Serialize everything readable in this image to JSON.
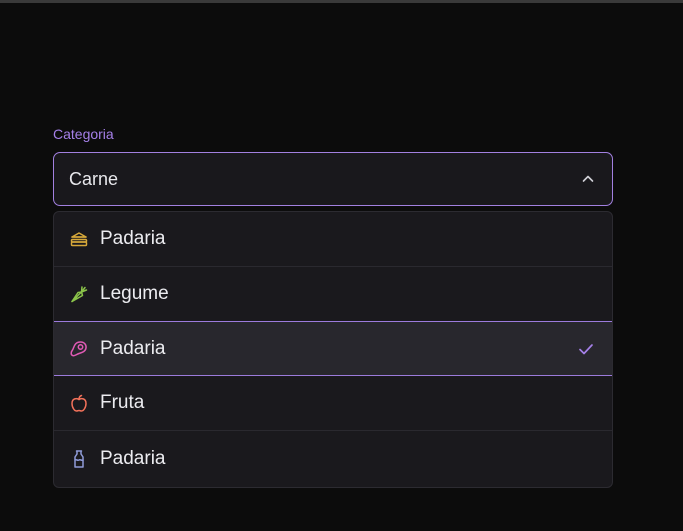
{
  "field": {
    "label": "Categoria",
    "value": "Carne"
  },
  "options": [
    {
      "label": "Padaria",
      "icon": "sandwich-icon",
      "color": "#d6a83a",
      "selected": false
    },
    {
      "label": "Legume",
      "icon": "carrot-icon",
      "color": "#8bc34a",
      "selected": false
    },
    {
      "label": "Padaria",
      "icon": "beef-icon",
      "color": "#e05ab4",
      "selected": true
    },
    {
      "label": "Fruta",
      "icon": "apple-icon",
      "color": "#f2715a",
      "selected": false
    },
    {
      "label": "Padaria",
      "icon": "milk-icon",
      "color": "#8f9bd8",
      "selected": false
    }
  ],
  "colors": {
    "accent": "#a580e8",
    "background": "#0c0c0c",
    "surface": "#1a191d"
  }
}
